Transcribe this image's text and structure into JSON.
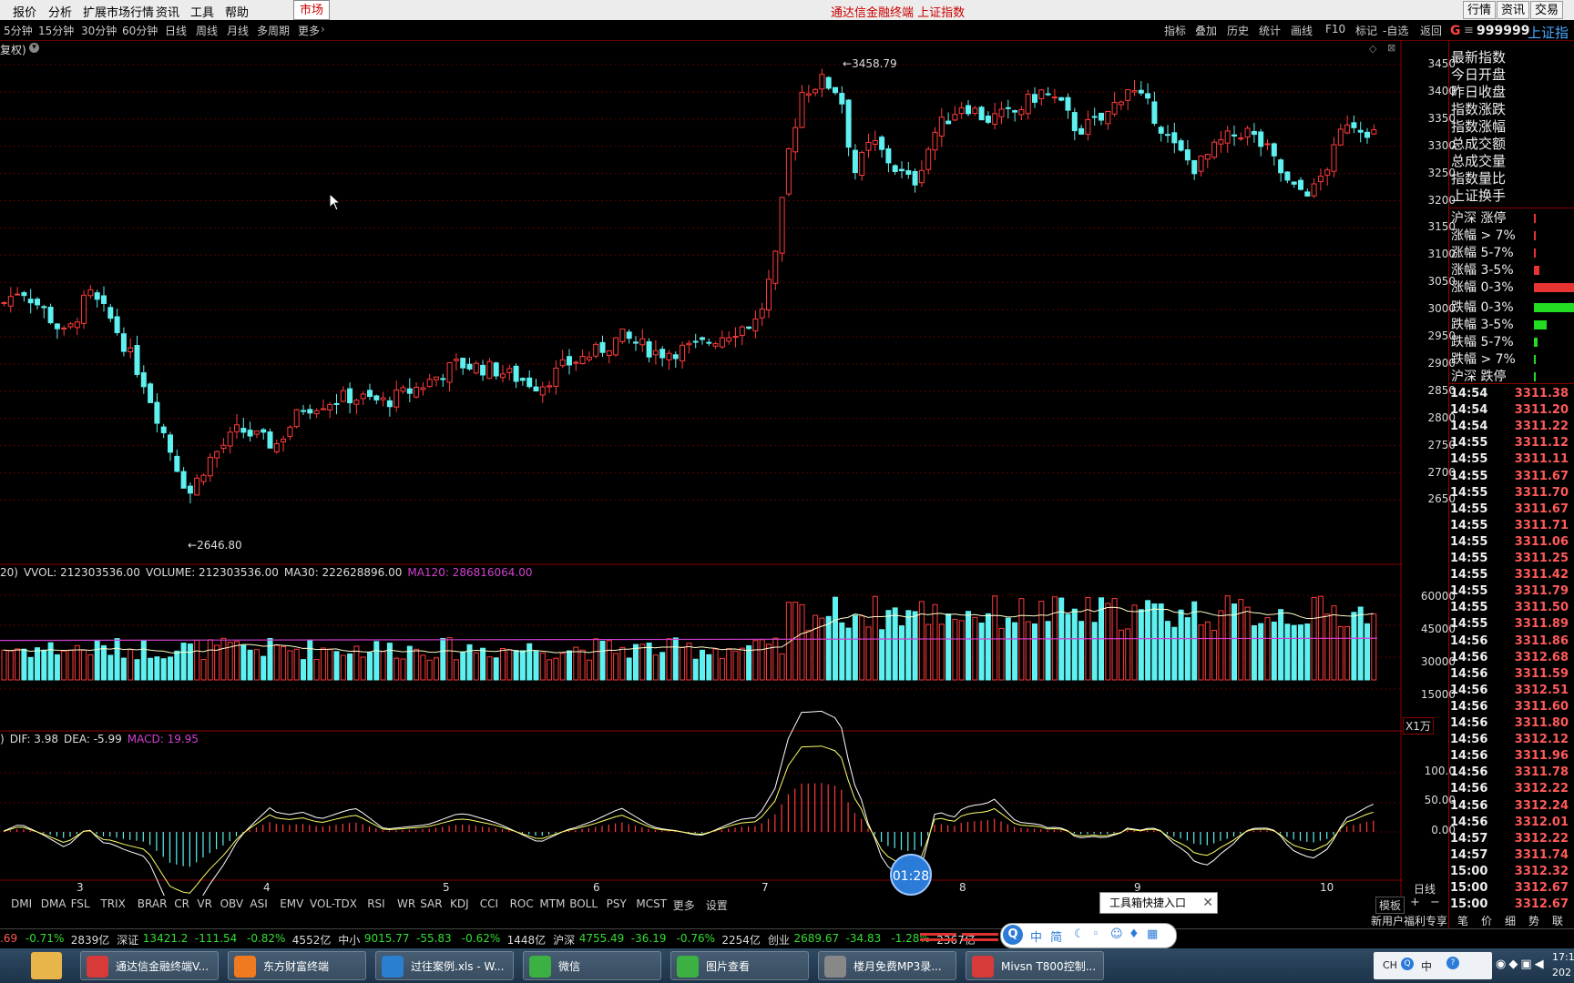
{
  "menubar": {
    "items": [
      "报价",
      "分析",
      "扩展市场行情",
      "资讯",
      "工具",
      "帮助"
    ],
    "market_tab": "市场",
    "title": "通达信金融终端 上证指数",
    "right_buttons": [
      "行情",
      "资讯",
      "交易"
    ]
  },
  "periods": [
    "5分钟",
    "15分钟",
    "30分钟",
    "60分钟",
    "日线",
    "周线",
    "月线",
    "多周期",
    "更多"
  ],
  "toolbar_right": [
    "指标",
    "叠加",
    "历史",
    "统计",
    "画线",
    "F10",
    "标记",
    "-自选",
    "返回"
  ],
  "quote_header": {
    "letter": "G",
    "code": "999999",
    "name": "上证指"
  },
  "price_pane": {
    "mode_label": "复权)",
    "high_label": "3458.79",
    "low_label": "2646.80",
    "y_ticks": [
      "3450",
      "3400",
      "3350",
      "3300",
      "3250",
      "3200",
      "3150",
      "3100",
      "3050",
      "3000",
      "2950",
      "2900",
      "2850",
      "2800",
      "2750",
      "2700",
      "2650"
    ]
  },
  "volume_pane": {
    "legend": [
      {
        "text": "20)",
        "color": "#dddddd"
      },
      {
        "text": "VVOL: 212303536.00",
        "color": "#dddddd"
      },
      {
        "text": "VOLUME: 212303536.00",
        "color": "#dddddd"
      },
      {
        "text": "MA30: 222628896.00",
        "color": "#dddddd"
      },
      {
        "text": "MA120: 286816064.00",
        "color": "#d040d0"
      }
    ],
    "y_ticks": [
      "60000",
      "45000",
      "30000",
      "15000"
    ],
    "unit": "X1万"
  },
  "macd_pane": {
    "legend": [
      {
        "text": ")",
        "color": "#dddddd"
      },
      {
        "text": "DIF: 3.98",
        "color": "#dddddd"
      },
      {
        "text": "DEA: -5.99",
        "color": "#dddddd"
      },
      {
        "text": "MACD: 19.95",
        "color": "#d040d0"
      }
    ],
    "y_ticks": [
      "100.0",
      "50.00",
      "0.00"
    ]
  },
  "x_axis": {
    "months": [
      "3",
      "4",
      "5",
      "6",
      "7",
      "8",
      "9",
      "10"
    ],
    "period_label": "日线"
  },
  "right_panel": {
    "index_labels": [
      "最新指数",
      "今日开盘",
      "昨日收盘",
      "指数涨跌",
      "指数涨幅",
      "总成交额",
      "总成交量",
      "指数量比",
      "上证换手"
    ],
    "breadth_labels": [
      "沪深 涨停",
      "涨幅 > 7%",
      "涨幅 5-7%",
      "涨幅 3-5%",
      "涨幅 0-3%",
      "跌幅 0-3%",
      "跌幅 3-5%",
      "跌幅 5-7%",
      "跌幅 > 7%",
      "沪深 跌停"
    ],
    "breadth_levels": [
      0.01,
      0.01,
      0.01,
      0.07,
      0.62,
      0.75,
      0.15,
      0.04,
      0.01,
      0.01
    ],
    "ticks": [
      {
        "t": "14:54",
        "p": "3311.38"
      },
      {
        "t": "14:54",
        "p": "3311.20"
      },
      {
        "t": "14:54",
        "p": "3311.22"
      },
      {
        "t": "14:55",
        "p": "3311.12"
      },
      {
        "t": "14:55",
        "p": "3311.11"
      },
      {
        "t": "14:55",
        "p": "3311.67"
      },
      {
        "t": "14:55",
        "p": "3311.70"
      },
      {
        "t": "14:55",
        "p": "3311.67"
      },
      {
        "t": "14:55",
        "p": "3311.71"
      },
      {
        "t": "14:55",
        "p": "3311.06"
      },
      {
        "t": "14:55",
        "p": "3311.25"
      },
      {
        "t": "14:55",
        "p": "3311.42"
      },
      {
        "t": "14:55",
        "p": "3311.79"
      },
      {
        "t": "14:55",
        "p": "3311.50"
      },
      {
        "t": "14:55",
        "p": "3311.89"
      },
      {
        "t": "14:56",
        "p": "3311.86"
      },
      {
        "t": "14:56",
        "p": "3312.68"
      },
      {
        "t": "14:56",
        "p": "3311.59"
      },
      {
        "t": "14:56",
        "p": "3312.51"
      },
      {
        "t": "14:56",
        "p": "3311.60"
      },
      {
        "t": "14:56",
        "p": "3311.80"
      },
      {
        "t": "14:56",
        "p": "3312.12"
      },
      {
        "t": "14:56",
        "p": "3311.96"
      },
      {
        "t": "14:56",
        "p": "3311.78"
      },
      {
        "t": "14:56",
        "p": "3312.22"
      },
      {
        "t": "14:56",
        "p": "3312.24"
      },
      {
        "t": "14:56",
        "p": "3312.01"
      },
      {
        "t": "14:57",
        "p": "3312.22"
      },
      {
        "t": "14:57",
        "p": "3311.74"
      },
      {
        "t": "15:00",
        "p": "3312.32"
      },
      {
        "t": "15:00",
        "p": "3312.67"
      },
      {
        "t": "15:00",
        "p": "3312.67"
      }
    ],
    "bottom_tabs": [
      "笔",
      "价",
      "细",
      "势",
      "联"
    ],
    "promo": "新用户福利专享"
  },
  "indicator_tabs": [
    "DMI",
    "DMA",
    "FSL",
    "TRIX",
    "BRAR",
    "CR",
    "VR",
    "OBV",
    "ASI",
    "EMV",
    "VOL-TDX",
    "RSI",
    "WR",
    "SAR",
    "KDJ",
    "CCI",
    "ROC",
    "MTM",
    "BOLL",
    "PSY",
    "MCST",
    "更多",
    "设置"
  ],
  "template_btn": "模板",
  "ticker": [
    {
      "text": ".69",
      "color": "#ff5a5a"
    },
    {
      "text": "-0.71%",
      "color": "#33dd33"
    },
    {
      "text": "2839亿",
      "color": "#dddddd"
    },
    {
      "text": "深证",
      "color": "#dddddd"
    },
    {
      "text": "13421.2",
      "color": "#33dd33"
    },
    {
      "text": "-111.54",
      "color": "#33dd33"
    },
    {
      "text": "-0.82%",
      "color": "#33dd33"
    },
    {
      "text": "4552亿",
      "color": "#dddddd"
    },
    {
      "text": "中小",
      "color": "#dddddd"
    },
    {
      "text": "9015.77",
      "color": "#33dd33"
    },
    {
      "text": "-55.83",
      "color": "#33dd33"
    },
    {
      "text": "-0.62%",
      "color": "#33dd33"
    },
    {
      "text": "1448亿",
      "color": "#dddddd"
    },
    {
      "text": "沪深",
      "color": "#dddddd"
    },
    {
      "text": "4755.49",
      "color": "#33dd33"
    },
    {
      "text": "-36.19",
      "color": "#33dd33"
    },
    {
      "text": "-0.76%",
      "color": "#33dd33"
    },
    {
      "text": "2254亿",
      "color": "#dddddd"
    },
    {
      "text": "创业",
      "color": "#dddddd"
    },
    {
      "text": "2689.67",
      "color": "#33dd33"
    },
    {
      "text": "-34.83",
      "color": "#33dd33"
    },
    {
      "text": "-1.28%",
      "color": "#33dd33"
    },
    {
      "text": "2367亿",
      "color": "#dddddd"
    }
  ],
  "overlays": {
    "timer": "01:28",
    "toolbox_tip": "工具箱快捷入口",
    "ime_chars": [
      "中",
      "简"
    ],
    "ime_lang": "CH",
    "ime_mode": "中"
  },
  "taskbar": {
    "tasks": [
      {
        "label": "通达信金融终端V...",
        "color": "#d83a3a"
      },
      {
        "label": "东方财富终端",
        "color": "#f07a20"
      },
      {
        "label": "过往案例.xls - W...",
        "color": "#2a7fd0"
      },
      {
        "label": "微信",
        "color": "#3cb043"
      },
      {
        "label": "图片查看",
        "color": "#3cb043"
      },
      {
        "label": "楼月免费MP3录...",
        "color": "#888888"
      },
      {
        "label": "Mivsn T800控制...",
        "color": "#d83a3a"
      }
    ],
    "clock": "17:1",
    "date": "202"
  }
}
